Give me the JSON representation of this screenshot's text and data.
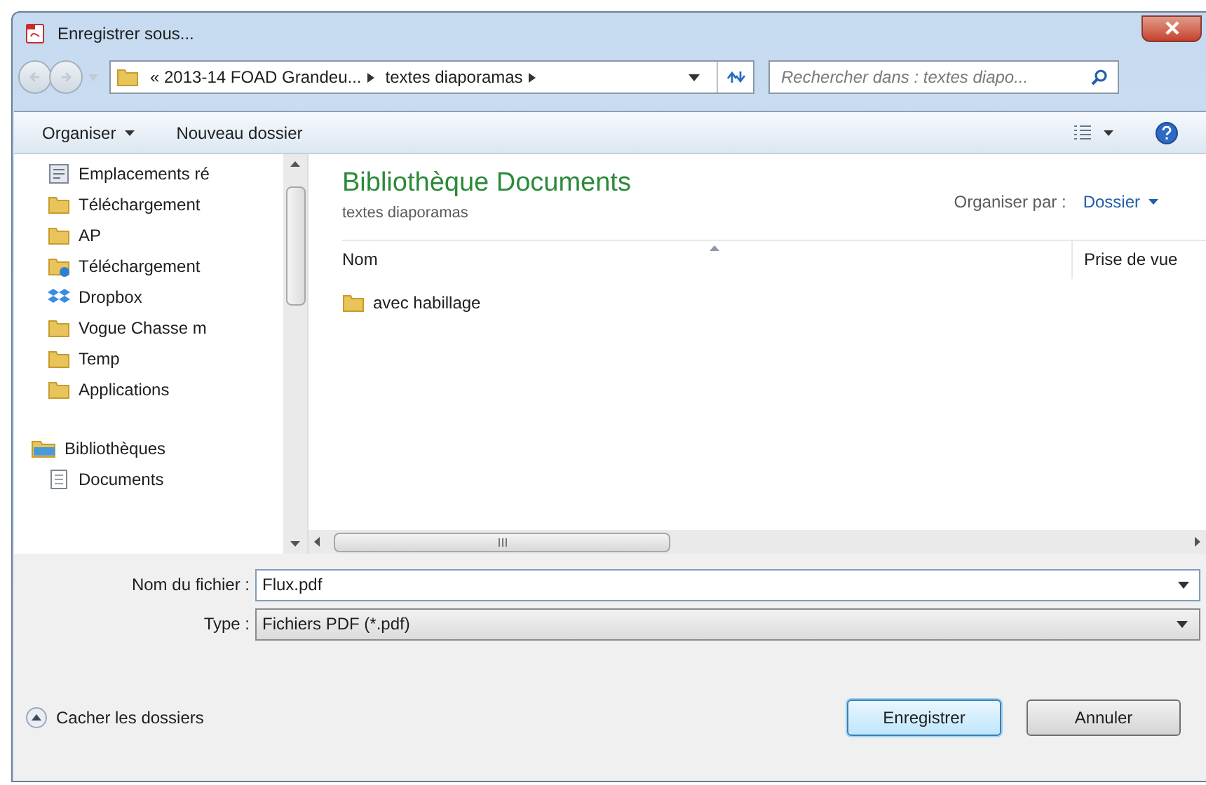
{
  "window": {
    "title": "Enregistrer sous..."
  },
  "address_bar": {
    "breadcrumbs": [
      "« 2013-14 FOAD Grandeu...",
      "textes diaporamas"
    ]
  },
  "search": {
    "placeholder": "Rechercher dans : textes diapo..."
  },
  "toolbar": {
    "organize": "Organiser",
    "new_folder": "Nouveau dossier"
  },
  "sidebar": {
    "items": [
      {
        "kind": "recent",
        "label": "Emplacements ré"
      },
      {
        "kind": "folder",
        "label": "Téléchargement"
      },
      {
        "kind": "folder",
        "label": "AP"
      },
      {
        "kind": "download",
        "label": "Téléchargement"
      },
      {
        "kind": "dropbox",
        "label": "Dropbox"
      },
      {
        "kind": "folder",
        "label": "Vogue Chasse m"
      },
      {
        "kind": "folder",
        "label": "Temp"
      },
      {
        "kind": "folder",
        "label": "Applications"
      },
      {
        "kind": "spacer"
      },
      {
        "kind": "library",
        "label": "Bibliothèques"
      },
      {
        "kind": "document",
        "label": "Documents"
      }
    ]
  },
  "library": {
    "title": "Bibliothèque Documents",
    "subtitle": "textes diaporamas",
    "arrange_label": "Organiser par :",
    "arrange_value": "Dossier"
  },
  "table": {
    "columns": [
      "Nom",
      "Prise de vue"
    ],
    "rows": [
      {
        "name": "avec habillage"
      }
    ]
  },
  "filename": {
    "label": "Nom du fichier :",
    "value": "Flux.pdf"
  },
  "filetype": {
    "label": "Type :",
    "value": "Fichiers PDF (*.pdf)"
  },
  "hide_folders": "Cacher les dossiers",
  "buttons": [
    {
      "label": "Enregistrer",
      "default": true
    },
    {
      "label": "Annuler",
      "default": false
    }
  ]
}
